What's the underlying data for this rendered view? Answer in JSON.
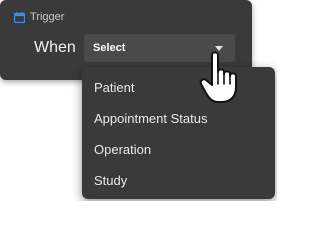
{
  "trigger": {
    "icon": "calendar-icon",
    "title": "Trigger",
    "when_label": "When",
    "select": {
      "value": "Select",
      "icon": "caret-down-icon"
    }
  },
  "dropdown": {
    "options": [
      "Patient",
      "Appointment Status",
      "Operation",
      "Study"
    ]
  },
  "cursor": {
    "icon": "hand-pointer-icon"
  },
  "colors": {
    "panel_background": "#3a3a3a",
    "select_background": "#4a4a4a",
    "icon_accent": "#3f8fe6",
    "text": "#e9e9e9"
  }
}
